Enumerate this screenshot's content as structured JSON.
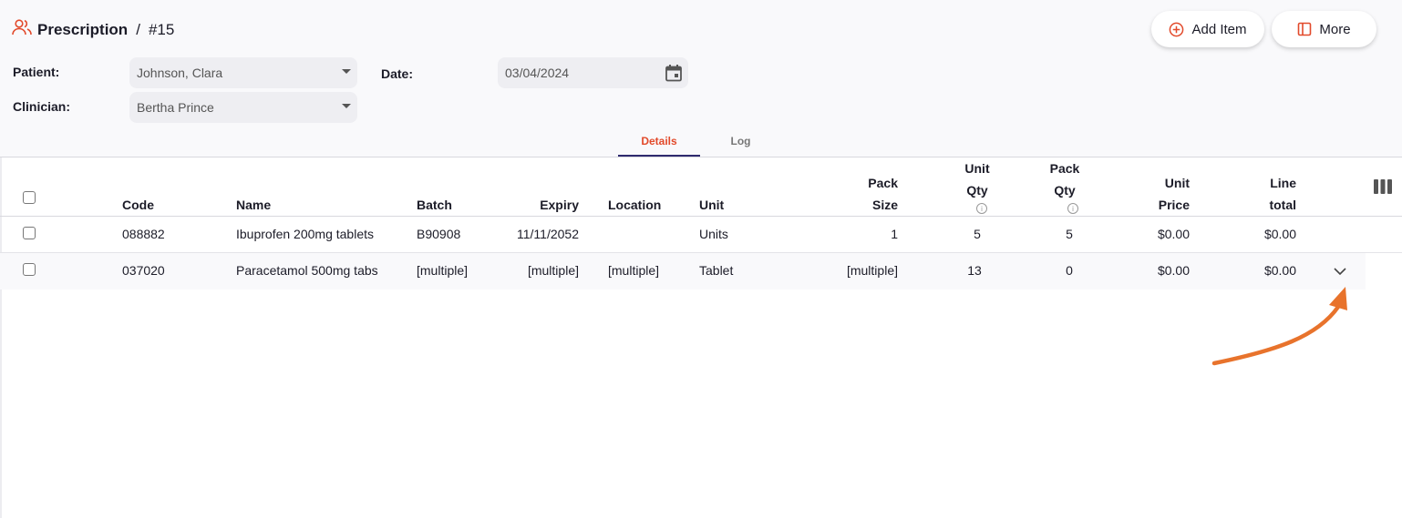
{
  "header": {
    "section": "Prescription",
    "separator": "/",
    "number": "#15",
    "section_icon": "people-icon"
  },
  "actions": {
    "add_item_label": "Add Item",
    "add_item_icon": "plus-circle-icon",
    "more_label": "More",
    "more_icon": "sidebar-panel-icon"
  },
  "form": {
    "patient_label": "Patient:",
    "patient_value": "Johnson, Clara",
    "clinician_label": "Clinician:",
    "clinician_value": "Bertha Prince",
    "date_label": "Date:",
    "date_value": "03/04/2024"
  },
  "tabs": {
    "details": "Details",
    "log": "Log",
    "active": "Details"
  },
  "table": {
    "columns": {
      "code": "Code",
      "name": "Name",
      "batch": "Batch",
      "expiry": "Expiry",
      "location": "Location",
      "unit": "Unit",
      "pack_size_1": "Pack",
      "pack_size_2": "Size",
      "unit_qty_1": "Unit",
      "unit_qty_2": "Qty",
      "pack_qty_1": "Pack",
      "pack_qty_2": "Qty",
      "unit_price_1": "Unit",
      "unit_price_2": "Price",
      "line_total_1": "Line",
      "line_total_2": "total"
    },
    "rows": [
      {
        "code": "088882",
        "name": "Ibuprofen 200mg tablets",
        "batch": "B90908",
        "expiry": "11/11/2052",
        "location": "",
        "unit": "Units",
        "pack_size": "1",
        "unit_qty": "5",
        "pack_qty": "5",
        "unit_price": "$0.00",
        "line_total": "$0.00"
      },
      {
        "code": "037020",
        "name": "Paracetamol 500mg tabs",
        "batch": "[multiple]",
        "expiry": "[multiple]",
        "location": "[multiple]",
        "unit": "Tablet",
        "pack_size": "[multiple]",
        "unit_qty": "13",
        "pack_qty": "0",
        "unit_price": "$0.00",
        "line_total": "$0.00"
      }
    ]
  },
  "colors": {
    "accent": "#e24a2b",
    "annotation_arrow": "#e8732c",
    "tab_underline": "#2e2a6e"
  }
}
